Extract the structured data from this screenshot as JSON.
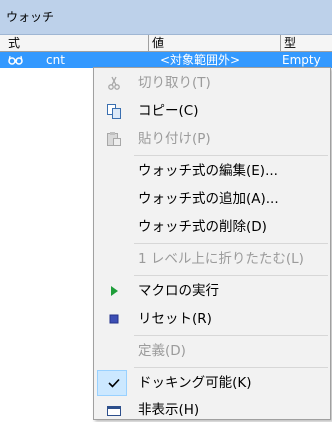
{
  "window": {
    "title": "ウォッチ"
  },
  "columns": {
    "expr": "式",
    "value": "値",
    "type": "型"
  },
  "watch_row": {
    "name": "cnt",
    "value": "<対象範囲外>",
    "type": "Empty",
    "icon": "glasses-icon"
  },
  "menu": {
    "cut": "切り取り(T)",
    "copy": "コピー(C)",
    "paste": "貼り付け(P)",
    "edit_watch": "ウォッチ式の編集(E)...",
    "add_watch": "ウォッチ式の追加(A)...",
    "delete_watch": "ウォッチ式の削除(D)",
    "collapse_parent": "1 レベル上に折りたたむ(L)",
    "run_macro": "マクロの実行",
    "reset": "リセット(R)",
    "definition": "定義(D)",
    "dockable": "ドッキング可能(K)",
    "hide": "非表示(H)"
  },
  "colors": {
    "selection": "#3399ff",
    "titlebar": "#bdd1ea",
    "menu_bg": "#f2f2f2",
    "disabled": "#9b9b9b",
    "check_bg": "#cce8ff"
  }
}
